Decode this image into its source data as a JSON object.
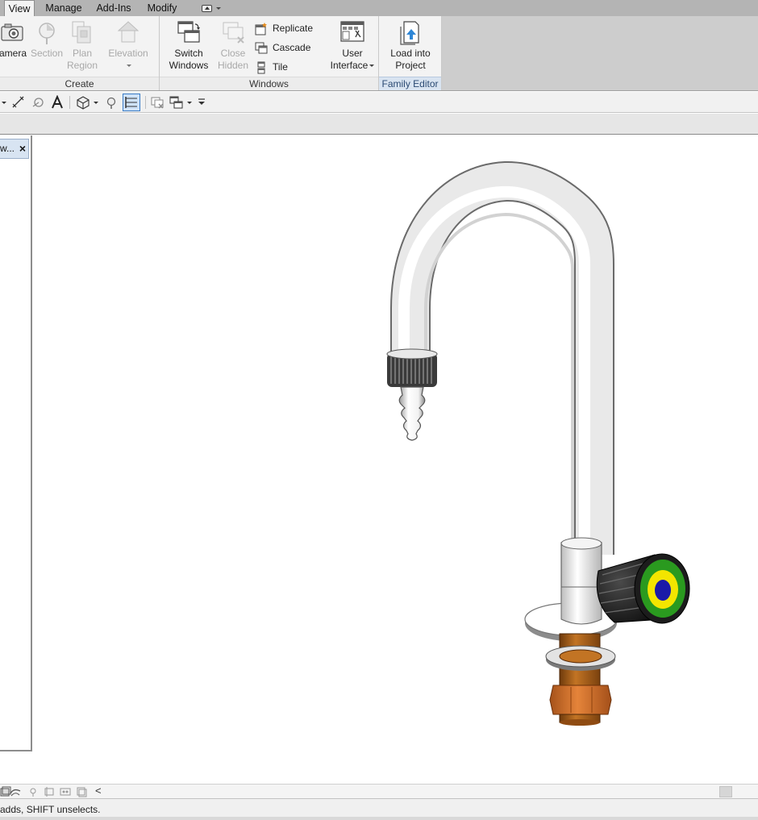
{
  "tabs": {
    "view": "View",
    "manage": "Manage",
    "addins": "Add-Ins",
    "modify": "Modify"
  },
  "ribbon": {
    "create": {
      "title": "Create",
      "camera": "amera",
      "section": "Section",
      "plan_region_1": "Plan",
      "plan_region_2": "Region",
      "elevation": "Elevation"
    },
    "windows": {
      "title": "Windows",
      "switch_windows_1": "Switch",
      "switch_windows_2": "Windows",
      "close_hidden_1": "Close",
      "close_hidden_2": "Hidden",
      "replicate": "Replicate",
      "cascade": "Cascade",
      "tile": "Tile",
      "user_interface_1": "User",
      "user_interface_2": "Interface"
    },
    "family_editor": {
      "title": "Family Editor",
      "load_into_project_1": "Load into",
      "load_into_project_2": "Project"
    }
  },
  "palette": {
    "title": "w...",
    "close": "×"
  },
  "status": {
    "text": "adds, SHIFT unselects."
  },
  "viewbar": {
    "collapse": "<"
  },
  "colors": {
    "ribbon_bg": "#f3f3f3",
    "tabbar_bg": "#b4b4b4",
    "family_editor_title_bg": "#d9e4f1",
    "knob_green": "#2a9a1f",
    "knob_yellow": "#f3e500",
    "knob_blue": "#1a1aa8",
    "pipe_copper": "#b86a1e",
    "nut_orange": "#d8762a"
  }
}
